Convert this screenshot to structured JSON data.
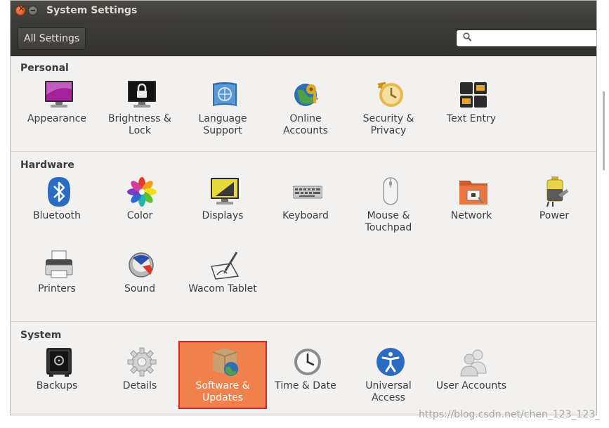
{
  "window": {
    "title": "System Settings"
  },
  "toolbar": {
    "all_settings_label": "All Settings",
    "search_placeholder": ""
  },
  "sections": [
    {
      "title": "Personal",
      "items": [
        {
          "label": "Appearance",
          "icon": "appearance-icon"
        },
        {
          "label": "Brightness & Lock",
          "icon": "brightness-lock-icon"
        },
        {
          "label": "Language Support",
          "icon": "language-support-icon"
        },
        {
          "label": "Online Accounts",
          "icon": "online-accounts-icon"
        },
        {
          "label": "Security & Privacy",
          "icon": "security-privacy-icon"
        },
        {
          "label": "Text Entry",
          "icon": "text-entry-icon"
        }
      ]
    },
    {
      "title": "Hardware",
      "items": [
        {
          "label": "Bluetooth",
          "icon": "bluetooth-icon"
        },
        {
          "label": "Color",
          "icon": "color-icon"
        },
        {
          "label": "Displays",
          "icon": "displays-icon"
        },
        {
          "label": "Keyboard",
          "icon": "keyboard-icon"
        },
        {
          "label": "Mouse & Touchpad",
          "icon": "mouse-touchpad-icon"
        },
        {
          "label": "Network",
          "icon": "network-icon"
        },
        {
          "label": "Power",
          "icon": "power-icon"
        },
        {
          "label": "Printers",
          "icon": "printers-icon"
        },
        {
          "label": "Sound",
          "icon": "sound-icon"
        },
        {
          "label": "Wacom Tablet",
          "icon": "wacom-tablet-icon"
        }
      ]
    },
    {
      "title": "System",
      "items": [
        {
          "label": "Backups",
          "icon": "backups-icon"
        },
        {
          "label": "Details",
          "icon": "details-icon"
        },
        {
          "label": "Software & Updates",
          "icon": "software-updates-icon",
          "selected": true
        },
        {
          "label": "Time & Date",
          "icon": "time-date-icon"
        },
        {
          "label": "Universal Access",
          "icon": "universal-access-icon"
        },
        {
          "label": "User Accounts",
          "icon": "user-accounts-icon"
        }
      ]
    }
  ],
  "watermark": "https://blog.csdn.net/chen_123_123_",
  "colors": {
    "selected_item": "#f0814c",
    "highlight_border": "#e0201a",
    "titlebar": "#3c3b37"
  }
}
